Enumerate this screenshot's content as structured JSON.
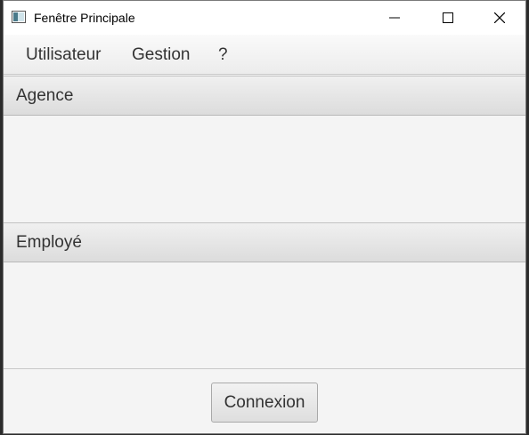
{
  "window": {
    "title": "Fenêtre Principale"
  },
  "menubar": {
    "items": [
      "Utilisateur",
      "Gestion",
      "?"
    ]
  },
  "panes": [
    {
      "title": "Agence"
    },
    {
      "title": "Employé"
    }
  ],
  "footer": {
    "button_label": "Connexion"
  }
}
